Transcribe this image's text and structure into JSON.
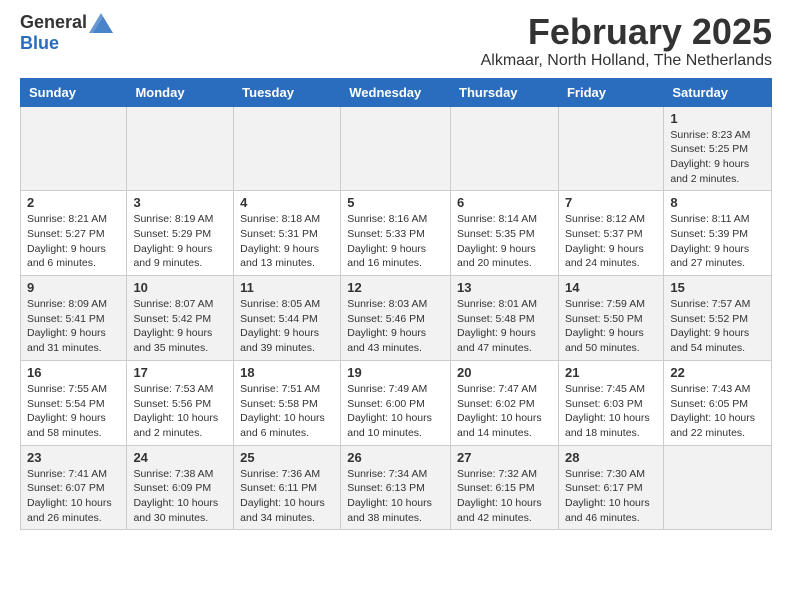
{
  "header": {
    "logo_general": "General",
    "logo_blue": "Blue",
    "month_title": "February 2025",
    "location": "Alkmaar, North Holland, The Netherlands"
  },
  "weekdays": [
    "Sunday",
    "Monday",
    "Tuesday",
    "Wednesday",
    "Thursday",
    "Friday",
    "Saturday"
  ],
  "weeks": [
    [
      {
        "day": "",
        "info": ""
      },
      {
        "day": "",
        "info": ""
      },
      {
        "day": "",
        "info": ""
      },
      {
        "day": "",
        "info": ""
      },
      {
        "day": "",
        "info": ""
      },
      {
        "day": "",
        "info": ""
      },
      {
        "day": "1",
        "info": "Sunrise: 8:23 AM\nSunset: 5:25 PM\nDaylight: 9 hours and 2 minutes."
      }
    ],
    [
      {
        "day": "2",
        "info": "Sunrise: 8:21 AM\nSunset: 5:27 PM\nDaylight: 9 hours and 6 minutes."
      },
      {
        "day": "3",
        "info": "Sunrise: 8:19 AM\nSunset: 5:29 PM\nDaylight: 9 hours and 9 minutes."
      },
      {
        "day": "4",
        "info": "Sunrise: 8:18 AM\nSunset: 5:31 PM\nDaylight: 9 hours and 13 minutes."
      },
      {
        "day": "5",
        "info": "Sunrise: 8:16 AM\nSunset: 5:33 PM\nDaylight: 9 hours and 16 minutes."
      },
      {
        "day": "6",
        "info": "Sunrise: 8:14 AM\nSunset: 5:35 PM\nDaylight: 9 hours and 20 minutes."
      },
      {
        "day": "7",
        "info": "Sunrise: 8:12 AM\nSunset: 5:37 PM\nDaylight: 9 hours and 24 minutes."
      },
      {
        "day": "8",
        "info": "Sunrise: 8:11 AM\nSunset: 5:39 PM\nDaylight: 9 hours and 27 minutes."
      }
    ],
    [
      {
        "day": "9",
        "info": "Sunrise: 8:09 AM\nSunset: 5:41 PM\nDaylight: 9 hours and 31 minutes."
      },
      {
        "day": "10",
        "info": "Sunrise: 8:07 AM\nSunset: 5:42 PM\nDaylight: 9 hours and 35 minutes."
      },
      {
        "day": "11",
        "info": "Sunrise: 8:05 AM\nSunset: 5:44 PM\nDaylight: 9 hours and 39 minutes."
      },
      {
        "day": "12",
        "info": "Sunrise: 8:03 AM\nSunset: 5:46 PM\nDaylight: 9 hours and 43 minutes."
      },
      {
        "day": "13",
        "info": "Sunrise: 8:01 AM\nSunset: 5:48 PM\nDaylight: 9 hours and 47 minutes."
      },
      {
        "day": "14",
        "info": "Sunrise: 7:59 AM\nSunset: 5:50 PM\nDaylight: 9 hours and 50 minutes."
      },
      {
        "day": "15",
        "info": "Sunrise: 7:57 AM\nSunset: 5:52 PM\nDaylight: 9 hours and 54 minutes."
      }
    ],
    [
      {
        "day": "16",
        "info": "Sunrise: 7:55 AM\nSunset: 5:54 PM\nDaylight: 9 hours and 58 minutes."
      },
      {
        "day": "17",
        "info": "Sunrise: 7:53 AM\nSunset: 5:56 PM\nDaylight: 10 hours and 2 minutes."
      },
      {
        "day": "18",
        "info": "Sunrise: 7:51 AM\nSunset: 5:58 PM\nDaylight: 10 hours and 6 minutes."
      },
      {
        "day": "19",
        "info": "Sunrise: 7:49 AM\nSunset: 6:00 PM\nDaylight: 10 hours and 10 minutes."
      },
      {
        "day": "20",
        "info": "Sunrise: 7:47 AM\nSunset: 6:02 PM\nDaylight: 10 hours and 14 minutes."
      },
      {
        "day": "21",
        "info": "Sunrise: 7:45 AM\nSunset: 6:03 PM\nDaylight: 10 hours and 18 minutes."
      },
      {
        "day": "22",
        "info": "Sunrise: 7:43 AM\nSunset: 6:05 PM\nDaylight: 10 hours and 22 minutes."
      }
    ],
    [
      {
        "day": "23",
        "info": "Sunrise: 7:41 AM\nSunset: 6:07 PM\nDaylight: 10 hours and 26 minutes."
      },
      {
        "day": "24",
        "info": "Sunrise: 7:38 AM\nSunset: 6:09 PM\nDaylight: 10 hours and 30 minutes."
      },
      {
        "day": "25",
        "info": "Sunrise: 7:36 AM\nSunset: 6:11 PM\nDaylight: 10 hours and 34 minutes."
      },
      {
        "day": "26",
        "info": "Sunrise: 7:34 AM\nSunset: 6:13 PM\nDaylight: 10 hours and 38 minutes."
      },
      {
        "day": "27",
        "info": "Sunrise: 7:32 AM\nSunset: 6:15 PM\nDaylight: 10 hours and 42 minutes."
      },
      {
        "day": "28",
        "info": "Sunrise: 7:30 AM\nSunset: 6:17 PM\nDaylight: 10 hours and 46 minutes."
      },
      {
        "day": "",
        "info": ""
      }
    ]
  ]
}
